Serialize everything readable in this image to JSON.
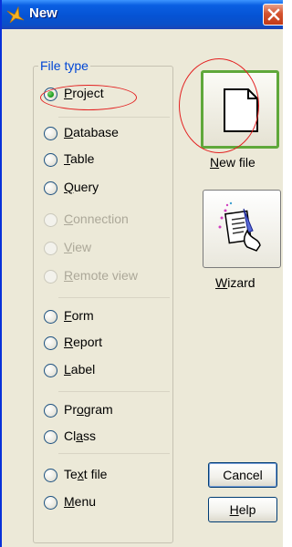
{
  "titlebar": {
    "title": "New",
    "icon": "app-icon",
    "close_icon": "close-icon"
  },
  "file_type": {
    "legend": "File type",
    "selected": "project",
    "options": [
      {
        "id": "project",
        "pre": "",
        "u": "P",
        "post": "roject",
        "checked": true,
        "enabled": true
      },
      {
        "id": "database",
        "pre": "",
        "u": "D",
        "post": "atabase",
        "checked": false,
        "enabled": true
      },
      {
        "id": "table",
        "pre": "",
        "u": "T",
        "post": "able",
        "checked": false,
        "enabled": true
      },
      {
        "id": "query",
        "pre": "",
        "u": "Q",
        "post": "uery",
        "checked": false,
        "enabled": true
      },
      {
        "id": "connection",
        "pre": "",
        "u": "C",
        "post": "onnection",
        "checked": false,
        "enabled": false
      },
      {
        "id": "view",
        "pre": "",
        "u": "V",
        "post": "iew",
        "checked": false,
        "enabled": false
      },
      {
        "id": "remote-view",
        "pre": "",
        "u": "R",
        "post": "emote view",
        "checked": false,
        "enabled": false
      },
      {
        "id": "form",
        "pre": "",
        "u": "F",
        "post": "orm",
        "checked": false,
        "enabled": true
      },
      {
        "id": "report",
        "pre": "",
        "u": "R",
        "post": "eport",
        "checked": false,
        "enabled": true
      },
      {
        "id": "label",
        "pre": "",
        "u": "L",
        "post": "abel",
        "checked": false,
        "enabled": true
      },
      {
        "id": "program",
        "pre": "Pr",
        "u": "o",
        "post": "gram",
        "checked": false,
        "enabled": true
      },
      {
        "id": "class",
        "pre": "Cl",
        "u": "a",
        "post": "ss",
        "checked": false,
        "enabled": true
      },
      {
        "id": "text-file",
        "pre": "Te",
        "u": "x",
        "post": "t file",
        "checked": false,
        "enabled": true
      },
      {
        "id": "menu",
        "pre": "",
        "u": "M",
        "post": "enu",
        "checked": false,
        "enabled": true
      }
    ]
  },
  "actions": {
    "new_file": {
      "pre": "",
      "u": "N",
      "post": "ew file",
      "icon": "blank-page-icon"
    },
    "wizard": {
      "pre": "",
      "u": "W",
      "post": "izard",
      "icon": "wizard-icon"
    },
    "cancel": {
      "label": "Cancel"
    },
    "help": {
      "pre": "",
      "u": "H",
      "post": "elp"
    }
  },
  "colors": {
    "title_bar": "#0553d4",
    "legend": "#0046d5",
    "annotation": "#e32020",
    "active_border": "#5fa83a"
  }
}
